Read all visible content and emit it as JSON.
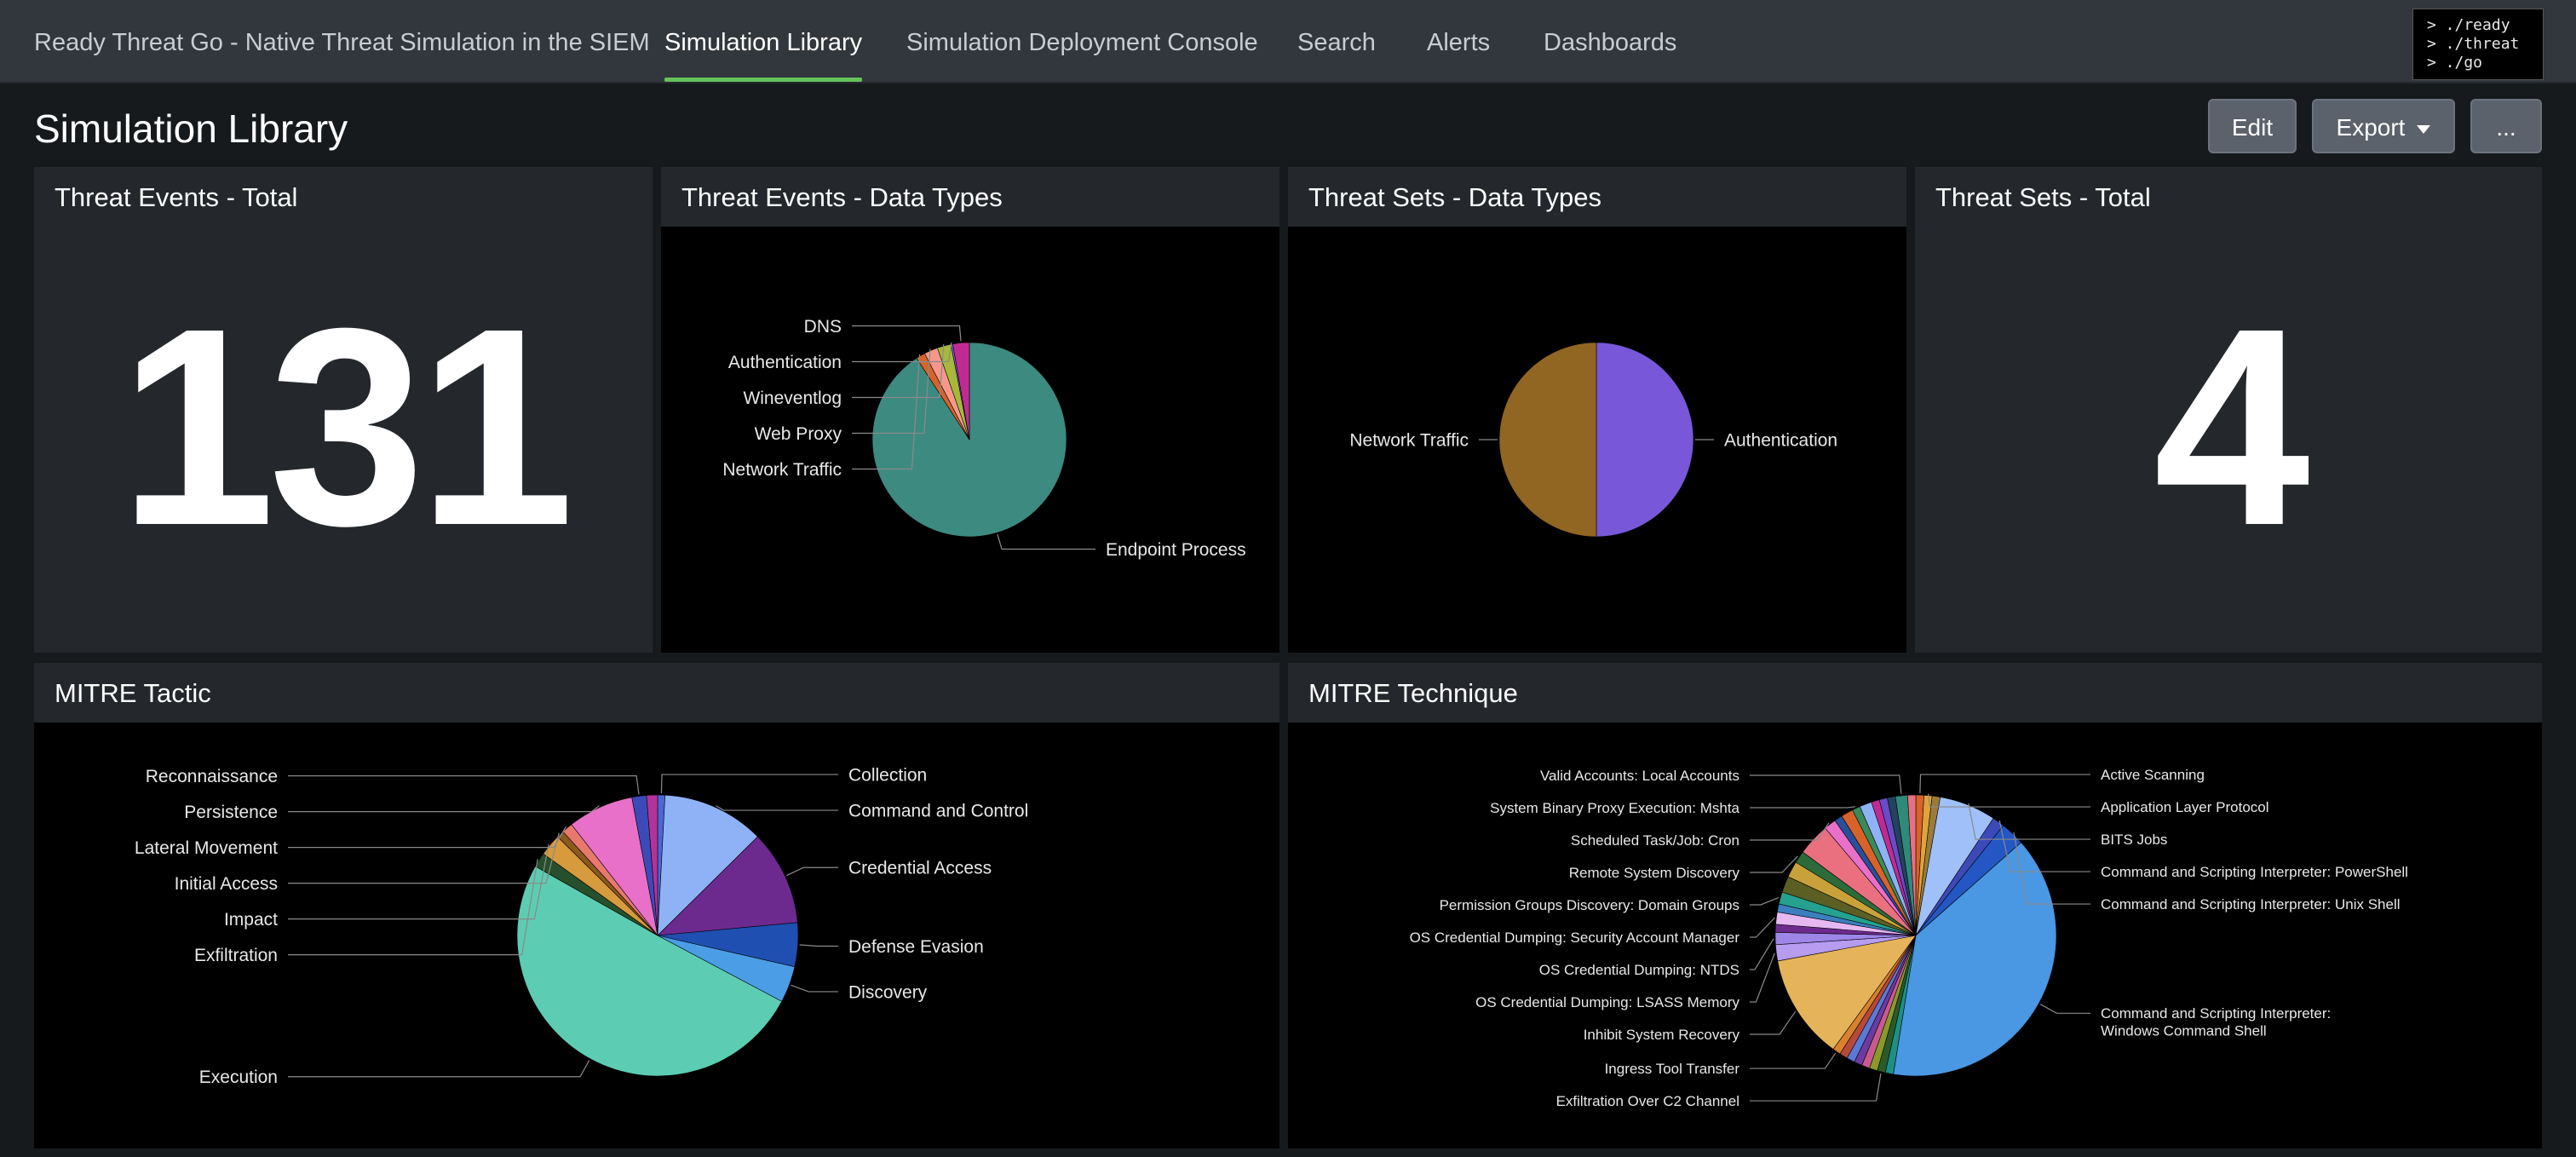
{
  "nav": {
    "app_title": "Ready Threat Go - Native Threat Simulation in the SIEM",
    "tabs": [
      "Simulation Library",
      "Simulation Deployment Console",
      "Search",
      "Alerts",
      "Dashboards"
    ],
    "active_tab": "Simulation Library",
    "logo_lines": [
      "> ./ready",
      "> ./threat",
      "> ./go"
    ]
  },
  "page": {
    "title": "Simulation Library",
    "edit_label": "Edit",
    "export_label": "Export",
    "more_label": "..."
  },
  "panels": {
    "threat_events_total": {
      "title": "Threat Events - Total",
      "value": "131"
    },
    "threat_events_types": {
      "title": "Threat Events - Data Types"
    },
    "threat_sets_types": {
      "title": "Threat Sets - Data Types"
    },
    "threat_sets_total": {
      "title": "Threat Sets - Total",
      "value": "4"
    },
    "mitre_tactic": {
      "title": "MITRE Tactic"
    },
    "mitre_technique": {
      "title": "MITRE Technique"
    }
  },
  "colors": {
    "accent_active_tab": "#65c25a",
    "panel_bg": "#24282c",
    "chart_bg": "#000000"
  },
  "chart_data": [
    {
      "id": "threat_events_types",
      "type": "pie",
      "slices": [
        {
          "label": "Endpoint Process",
          "value": 119,
          "color": "#3d8a80"
        },
        {
          "label": "Network Traffic",
          "value": 2,
          "color": "#d8632a"
        },
        {
          "label": "Web Proxy",
          "value": 3,
          "color": "#f5988b"
        },
        {
          "label": "Wineventlog",
          "value": 3,
          "color": "#a7b83a"
        },
        {
          "label": "Authentication",
          "value": 0.4,
          "color": "#7b5fe0"
        },
        {
          "label": "DNS",
          "value": 3.6,
          "color": "#c02b93"
        }
      ]
    },
    {
      "id": "threat_sets_types",
      "type": "pie",
      "slices": [
        {
          "label": "Authentication",
          "value": 2,
          "color": "#7858d8"
        },
        {
          "label": "Network Traffic",
          "value": 2,
          "color": "#916522"
        }
      ]
    },
    {
      "id": "mitre_tactic",
      "type": "pie",
      "slices": [
        {
          "label": "Collection",
          "value": 1,
          "color": "#4a67d6"
        },
        {
          "label": "Command and Control",
          "value": 14,
          "color": "#8fb2f6"
        },
        {
          "label": "Credential Access",
          "value": 13,
          "color": "#6d2a8e"
        },
        {
          "label": "Defense Evasion",
          "value": 6,
          "color": "#1f4fb0"
        },
        {
          "label": "Discovery",
          "value": 5,
          "color": "#4b9de6"
        },
        {
          "label": "Execution",
          "value": 60,
          "color": "#5ccdb2"
        },
        {
          "label": "Exfiltration",
          "value": 2,
          "color": "#274f2b"
        },
        {
          "label": "Impact",
          "value": 3,
          "color": "#d79a3c"
        },
        {
          "label": "Initial Access",
          "value": 1,
          "color": "#8a5a1e"
        },
        {
          "label": "Lateral Movement",
          "value": 1.5,
          "color": "#e9786e"
        },
        {
          "label": "Persistence",
          "value": 9,
          "color": "#e870c9"
        },
        {
          "label": "Reconnaissance",
          "value": 2,
          "color": "#3c4ab8"
        },
        {
          "label": "",
          "value": 1.5,
          "color": "#b2339a"
        }
      ]
    },
    {
      "id": "mitre_technique",
      "type": "pie",
      "slices": [
        {
          "label": "Active Scanning",
          "value": 1,
          "color": "#d8632a"
        },
        {
          "label": "Application Layer Protocol",
          "value": 1,
          "color": "#e0a33b"
        },
        {
          "label": "",
          "value": 1,
          "color": "#9a7b3a"
        },
        {
          "label": "BITS Jobs",
          "value": 7,
          "color": "#9fc0f8"
        },
        {
          "label": "Command and Scripting Interpreter: PowerShell",
          "value": 1.5,
          "color": "#3c4ab8"
        },
        {
          "label": "Command and Scripting Interpreter: Unix Shell",
          "value": 3,
          "color": "#2457c4"
        },
        {
          "label": "Command and Scripting Interpreter:\nWindows Command Shell",
          "value": 42,
          "color": "#4a97e3"
        },
        {
          "label": "",
          "value": 1,
          "color": "#1c8f86"
        },
        {
          "label": "Exfiltration Over C2 Channel",
          "value": 1,
          "color": "#2a5a2a"
        },
        {
          "label": "",
          "value": 1,
          "color": "#8a9a2a"
        },
        {
          "label": "",
          "value": 1,
          "color": "#c85b8e"
        },
        {
          "label": "",
          "value": 1,
          "color": "#6d3aa0"
        },
        {
          "label": "",
          "value": 1,
          "color": "#5b7ad8"
        },
        {
          "label": "",
          "value": 1,
          "color": "#b54a3a"
        },
        {
          "label": "Ingress Tool Transfer",
          "value": 1,
          "color": "#d9812e"
        },
        {
          "label": "Inhibit System Recovery",
          "value": 13,
          "color": "#e5b45a"
        },
        {
          "label": "OS Credential Dumping: LSASS Memory",
          "value": 2,
          "color": "#b79cf0"
        },
        {
          "label": "OS Credential Dumping: NTDS",
          "value": 1.5,
          "color": "#9d86e8"
        },
        {
          "label": "",
          "value": 1,
          "color": "#6d2a8e"
        },
        {
          "label": "OS Credential Dumping: Security Account Manager",
          "value": 1.5,
          "color": "#e6b8f2"
        },
        {
          "label": "",
          "value": 1,
          "color": "#3b7fbf"
        },
        {
          "label": "Permission Groups Discovery: Domain Groups",
          "value": 1.5,
          "color": "#26a08f"
        },
        {
          "label": "",
          "value": 2,
          "color": "#5b5f24"
        },
        {
          "label": "",
          "value": 2,
          "color": "#c9a13a"
        },
        {
          "label": "Remote System Discovery",
          "value": 1.5,
          "color": "#2d6b3a"
        },
        {
          "label": "",
          "value": 4,
          "color": "#ea7080"
        },
        {
          "label": "Scheduled Task/Job: Cron",
          "value": 1.5,
          "color": "#e870c9"
        },
        {
          "label": "",
          "value": 1,
          "color": "#2a4f9a"
        },
        {
          "label": "",
          "value": 1.5,
          "color": "#d8632a"
        },
        {
          "label": "System Binary Proxy Execution: Mshta",
          "value": 1,
          "color": "#3a8a5a"
        },
        {
          "label": "",
          "value": 1.5,
          "color": "#8fb2f6"
        },
        {
          "label": "",
          "value": 1,
          "color": "#c02b93"
        },
        {
          "label": "",
          "value": 1,
          "color": "#6a4bc8"
        },
        {
          "label": "",
          "value": 1,
          "color": "#23425e"
        },
        {
          "label": "Valid Accounts: Local Accounts",
          "value": 1.5,
          "color": "#2f8a7a"
        },
        {
          "label": "",
          "value": 1,
          "color": "#ea7080"
        }
      ]
    }
  ]
}
